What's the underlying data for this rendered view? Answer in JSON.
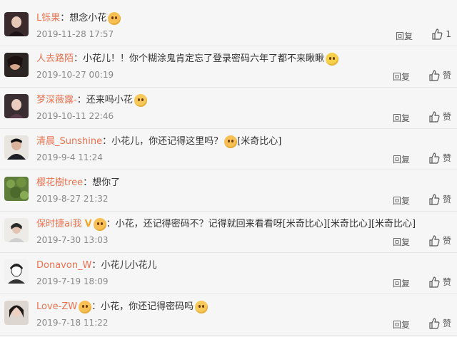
{
  "comments": [
    {
      "user": "L铄果",
      "text": "想念小花",
      "emoji": "kiss",
      "date": "2019-11-28 17:57",
      "reply": "回复",
      "like": "1"
    },
    {
      "user": "人去路陌",
      "text": "小花儿！！你个糊涂鬼肯定忘了登录密码六年了都不来瞅瞅",
      "emoji": "side",
      "date": "2019-10-27 00:19",
      "reply": "回复",
      "like": "赞"
    },
    {
      "user": "梦深薇露-",
      "text": "还来吗小花",
      "emoji": "cry",
      "date": "2019-10-11 22:46",
      "reply": "回复",
      "like": "赞"
    },
    {
      "user": "清晨_Sunshine",
      "text": "小花儿，你还记得这里吗？",
      "emoji": "kiss",
      "suffix": "[米奇比心]",
      "date": "2019-9-4 11:24",
      "reply": "回复",
      "like": "赞"
    },
    {
      "user": "樱花樹tree",
      "text": "想你了",
      "date": "2019-8-27 21:32",
      "reply": "回复",
      "like": "赞"
    },
    {
      "user": "保时捷ai我",
      "badge": "V",
      "text": "小花，还记得密码不？记得就回来看看呀[米奇比心][米奇比心][米奇比心]",
      "date": "2019-7-30 13:03",
      "reply": "回复",
      "like": "赞"
    },
    {
      "user": "Donavon_W",
      "text": "小花儿小花儿",
      "date": "2019-7-19 18:09",
      "reply": "回复",
      "like": "赞"
    },
    {
      "user": "Love-ZW",
      "text": "小花，你还记得密码吗",
      "emoji": "cry",
      "date": "2019-7-18 11:22",
      "reply": "回复",
      "like": "赞"
    }
  ],
  "icons": {
    "like": "thumbs-up-icon"
  },
  "colors": {
    "username": "#eb7350",
    "meta": "#888888",
    "background": "#f6f6f6"
  }
}
